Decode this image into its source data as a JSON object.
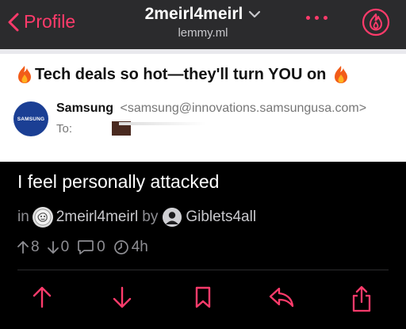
{
  "nav": {
    "back_label": "Profile",
    "community": "2meirl4meirl",
    "instance": "lemmy.ml"
  },
  "email": {
    "subject": "Tech deals so hot—they'll turn YOU on",
    "avatar_text": "SAMSUNG",
    "sender_name": "Samsung",
    "sender_email": "<samsung@innovations.samsungusa.com>",
    "to_label": "To:"
  },
  "post": {
    "title": "I feel personally attacked",
    "in_label": "in",
    "community": "2meirl4meirl",
    "by_label": "by",
    "author": "Giblets4all",
    "upvotes": "8",
    "downvotes": "0",
    "comments": "0",
    "age": "4h"
  },
  "colors": {
    "accent": "#ff3b6b",
    "navbar_bg": "#2b2b2d",
    "background": "#000000"
  },
  "icons": [
    "chevron-left-icon",
    "chevron-down-icon",
    "ellipsis-icon",
    "flame-icon",
    "upvote-icon",
    "downvote-icon",
    "bookmark-icon",
    "reply-icon",
    "share-icon",
    "clock-icon",
    "comment-icon"
  ]
}
